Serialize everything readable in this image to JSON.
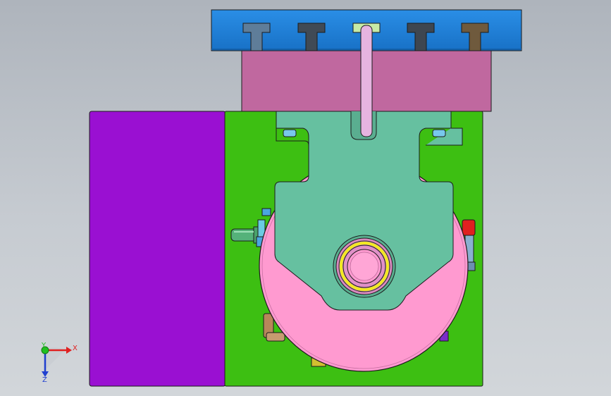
{
  "viewport": {
    "background_top": "#aeb4bc",
    "background_bottom": "#d2d6da"
  },
  "colors": {
    "top_plate": "#1e7fd8",
    "top_plate_dark": "#145fa8",
    "mid_block": "#c0689f",
    "base_plate": "#3dbf12",
    "side_plate": "#9a10d2",
    "bracket": "#66c0a0",
    "disk": "#ff9ad0",
    "bearing_ring": "#f2ea22",
    "outline": "#1c1c1c"
  },
  "t_slot_colors": [
    "#5f7d99",
    "#404a55",
    "#c7eaa6",
    "#3e4650",
    "#6f5a3d"
  ],
  "triad": {
    "x_label": "X",
    "y_label": "Y",
    "z_label": "Z",
    "x_color": "#e02020",
    "y_color": "#20c020",
    "z_color": "#2040d0",
    "icon": "coordinate-triad-icon"
  }
}
